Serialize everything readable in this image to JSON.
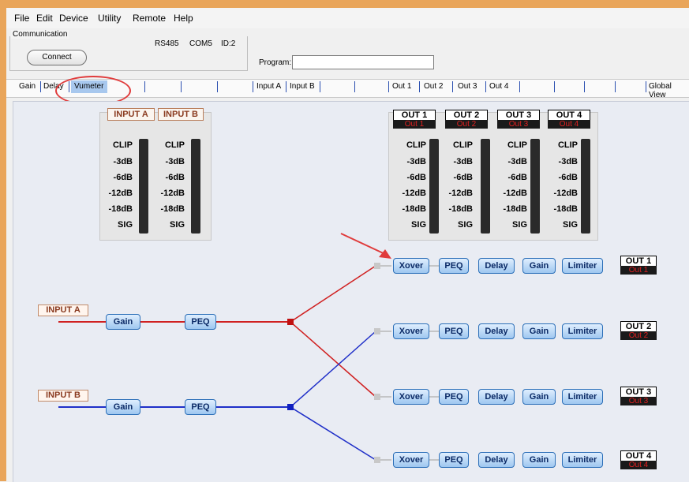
{
  "menu": [
    "File",
    "Edit",
    "Device",
    "Utility",
    "Remote",
    "Help"
  ],
  "communication": {
    "label": "Communication",
    "connect_label": "Connect",
    "port": "RS485",
    "com": "COM5",
    "id": "ID:2"
  },
  "program": {
    "label": "Program:",
    "value": ""
  },
  "tabs": [
    "Gain",
    "Delay",
    "Vumeter",
    "Input A",
    "Input B",
    "Out 1",
    "Out 2",
    "Out 3",
    "Out 4",
    "Global View"
  ],
  "meters": {
    "inputs": [
      "INPUT A",
      "INPUT B"
    ],
    "outputs": [
      {
        "name": "OUT 1",
        "sub": "Out 1"
      },
      {
        "name": "OUT 2",
        "sub": "Out 2"
      },
      {
        "name": "OUT 3",
        "sub": "Out 3"
      },
      {
        "name": "OUT 4",
        "sub": "Out 4"
      }
    ],
    "levels": [
      "CLIP",
      "-3dB",
      "-6dB",
      "-12dB",
      "-18dB",
      "SIG"
    ]
  },
  "routing": {
    "inputs": [
      {
        "label": "INPUT A",
        "gain": "Gain",
        "peq": "PEQ",
        "color": "#d02020"
      },
      {
        "label": "INPUT B",
        "gain": "Gain",
        "peq": "PEQ",
        "color": "#1f2fc8"
      }
    ],
    "output_chain": [
      "Xover",
      "PEQ",
      "Delay",
      "Gain",
      "Limiter"
    ],
    "outputs": [
      {
        "name": "OUT 1",
        "sub": "Out 1"
      },
      {
        "name": "OUT 2",
        "sub": "Out 2"
      },
      {
        "name": "OUT 3",
        "sub": "Out 3"
      },
      {
        "name": "OUT 4",
        "sub": "Out 4"
      }
    ]
  },
  "colors": {
    "accent": "#e9a55a",
    "active_tab": "#a8c8ee",
    "highlight": "#e03b3b"
  }
}
